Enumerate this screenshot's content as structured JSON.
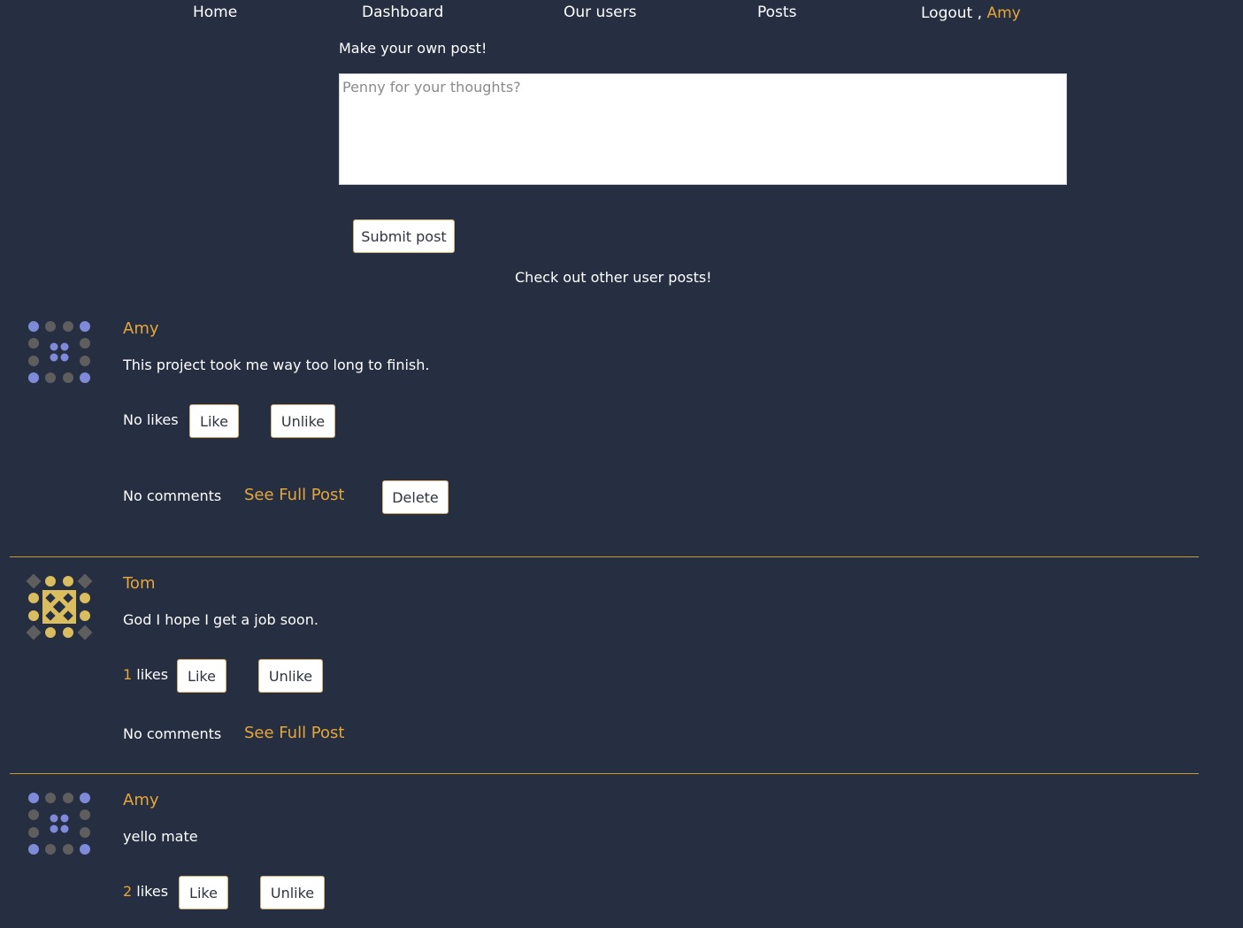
{
  "nav": {
    "home": "Home",
    "dashboard": "Dashboard",
    "users": "Our users",
    "posts": "Posts",
    "logout": "Logout",
    "separator": ",",
    "current_user": "Amy"
  },
  "compose": {
    "heading": "Make your own post!",
    "placeholder": "Penny for your thoughts?",
    "submit_label": "Submit post"
  },
  "feed_heading": "Check out other user posts!",
  "buttons": {
    "like": "Like",
    "unlike": "Unlike",
    "delete": "Delete",
    "see_full_post": "See Full Post",
    "no_comments": "No comments",
    "no_likes": "No likes",
    "likes_suffix": "likes"
  },
  "posts": [
    {
      "author": "Amy",
      "text": "This project took me way too long to finish.",
      "likes": "",
      "avatar": "identicon-blue-dots-icon"
    },
    {
      "author": "Tom",
      "text": "God I hope I get a job soon.",
      "likes": "1",
      "avatar": "identicon-gold-diamond-icon"
    },
    {
      "author": "Amy",
      "text": "yello mate",
      "likes": "2",
      "avatar": "identicon-blue-dots-icon"
    }
  ],
  "colors": {
    "background": "#262e42",
    "accent": "#e5a63a",
    "avatar_blue": "#7f8bd8",
    "avatar_gray": "#5e5e5e",
    "avatar_gold": "#d9bd5e"
  }
}
